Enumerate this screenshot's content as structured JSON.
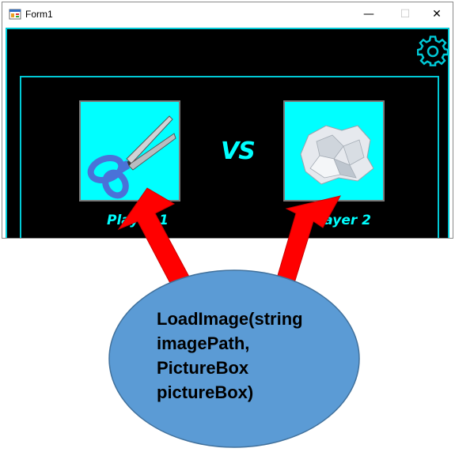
{
  "window": {
    "title": "Form1",
    "minimize_glyph": "—",
    "maximize_glyph": "☐",
    "close_glyph": "✕"
  },
  "game": {
    "vs_label": "VS",
    "player1": {
      "label": "Player 1",
      "image_icon": "scissors-icon"
    },
    "player2": {
      "label": "Player 2",
      "image_icon": "crumpled-paper-icon"
    },
    "settings_icon": "gear-icon"
  },
  "annotation": {
    "callout_lines": [
      "LoadImage(string",
      "imagePath,",
      "PictureBox",
      "pictureBox)"
    ],
    "arrow_color": "#ff0000",
    "bubble_color": "#5b9bd5"
  },
  "colors": {
    "accent": "#00ffff",
    "frame": "#00c9d6",
    "background": "#000000"
  }
}
